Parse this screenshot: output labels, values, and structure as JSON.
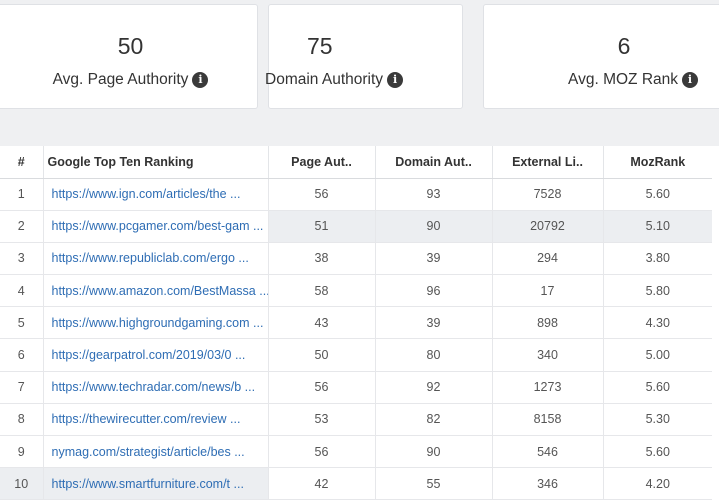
{
  "cards": [
    {
      "value": "50",
      "label": "Avg. Page Authority"
    },
    {
      "value": "75",
      "label": "Domain Authority"
    },
    {
      "value": "6",
      "label": "Avg. MOZ Rank"
    }
  ],
  "info_icon_glyph": "i",
  "table": {
    "headers": [
      "#",
      "Google Top Ten Ranking",
      "Page Aut..",
      "Domain Aut..",
      "External Li..",
      "MozRank"
    ],
    "rows": [
      {
        "n": "1",
        "url": "https://www.ign.com/articles/the ...",
        "pa": "56",
        "da": "93",
        "el": "7528",
        "mr": "5.60"
      },
      {
        "n": "2",
        "url": "https://www.pcgamer.com/best-gam ...",
        "pa": "51",
        "da": "90",
        "el": "20792",
        "mr": "5.10"
      },
      {
        "n": "3",
        "url": "https://www.republiclab.com/ergo ...",
        "pa": "38",
        "da": "39",
        "el": "294",
        "mr": "3.80"
      },
      {
        "n": "4",
        "url": "https://www.amazon.com/BestMassa ...",
        "pa": "58",
        "da": "96",
        "el": "17",
        "mr": "5.80"
      },
      {
        "n": "5",
        "url": "https://www.highgroundgaming.com ...",
        "pa": "43",
        "da": "39",
        "el": "898",
        "mr": "4.30"
      },
      {
        "n": "6",
        "url": "https://gearpatrol.com/2019/03/0 ...",
        "pa": "50",
        "da": "80",
        "el": "340",
        "mr": "5.00"
      },
      {
        "n": "7",
        "url": "https://www.techradar.com/news/b ...",
        "pa": "56",
        "da": "92",
        "el": "1273",
        "mr": "5.60"
      },
      {
        "n": "8",
        "url": "https://thewirecutter.com/review ...",
        "pa": "53",
        "da": "82",
        "el": "8158",
        "mr": "5.30"
      },
      {
        "n": "9",
        "url": "nymag.com/strategist/article/bes ...",
        "pa": "56",
        "da": "90",
        "el": "546",
        "mr": "5.60"
      },
      {
        "n": "10",
        "url": "https://www.smartfurniture.com/t ...",
        "pa": "42",
        "da": "55",
        "el": "346",
        "mr": "4.20"
      }
    ]
  }
}
